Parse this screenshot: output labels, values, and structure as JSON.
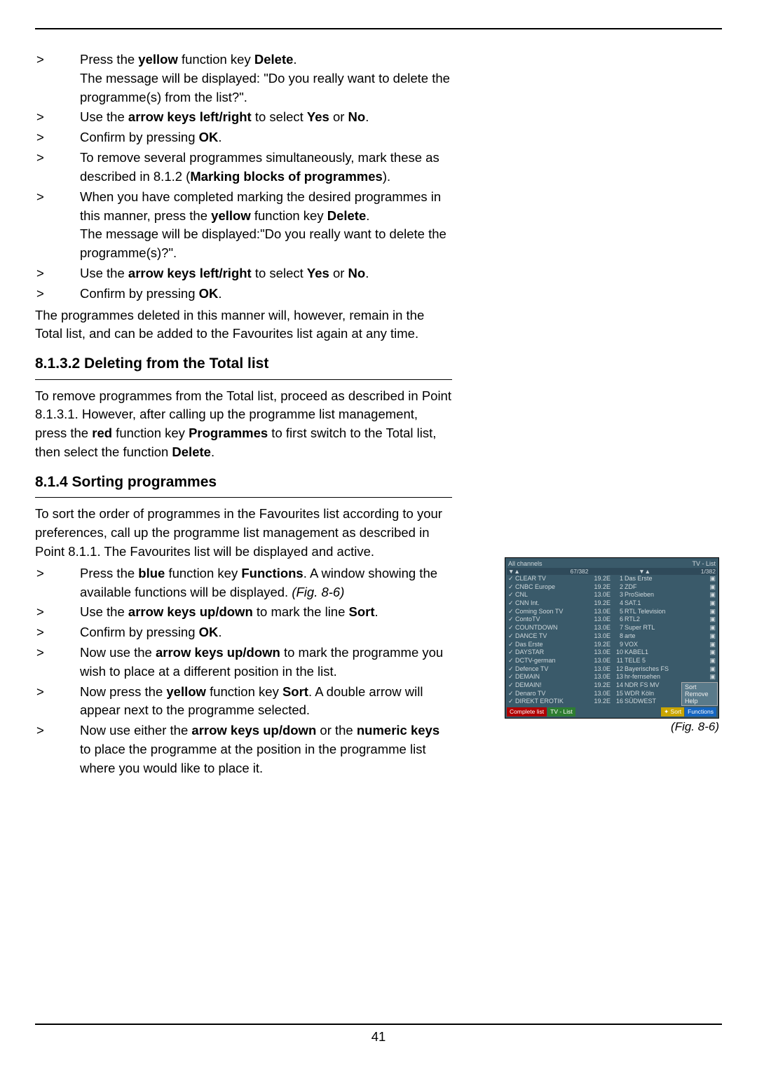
{
  "page_number": "41",
  "items": [
    {
      "marker": ">",
      "fragments": [
        {
          "t": "Press the "
        },
        {
          "t": "yellow",
          "b": 1
        },
        {
          "t": " function key "
        },
        {
          "t": "Delete",
          "b": 1
        },
        {
          "t": "."
        },
        {
          "br": 1
        },
        {
          "t": "The message will be displayed: \"Do you really want to delete the programme(s) from the list?\"."
        }
      ]
    },
    {
      "marker": ">",
      "fragments": [
        {
          "t": "Use the "
        },
        {
          "t": "arrow keys left/right",
          "b": 1
        },
        {
          "t": " to select "
        },
        {
          "t": "Yes",
          "b": 1
        },
        {
          "t": " or "
        },
        {
          "t": "No",
          "b": 1
        },
        {
          "t": "."
        }
      ]
    },
    {
      "marker": ">",
      "fragments": [
        {
          "t": "Confirm by pressing "
        },
        {
          "t": "OK",
          "b": 1
        },
        {
          "t": "."
        }
      ]
    },
    {
      "marker": ">",
      "fragments": [
        {
          "t": "To remove several programmes simultaneously, mark these as described in 8.1.2 ("
        },
        {
          "t": "Marking blocks of programmes",
          "b": 1
        },
        {
          "t": ")."
        }
      ]
    },
    {
      "marker": ">",
      "fragments": [
        {
          "t": "When you have completed marking the desired programmes in this manner, press the "
        },
        {
          "t": "yellow",
          "b": 1
        },
        {
          "t": " function key "
        },
        {
          "t": "Delete",
          "b": 1
        },
        {
          "t": "."
        },
        {
          "br": 1
        },
        {
          "t": "The message will be displayed:\"Do you really want to delete the programme(s)?\"."
        }
      ]
    },
    {
      "marker": ">",
      "fragments": [
        {
          "t": "Use the "
        },
        {
          "t": "arrow keys left/right",
          "b": 1
        },
        {
          "t": " to select "
        },
        {
          "t": "Yes",
          "b": 1
        },
        {
          "t": " or "
        },
        {
          "t": "No",
          "b": 1
        },
        {
          "t": "."
        }
      ]
    },
    {
      "marker": ">",
      "fragments": [
        {
          "t": "Confirm by pressing "
        },
        {
          "t": "OK",
          "b": 1
        },
        {
          "t": "."
        }
      ]
    }
  ],
  "after_items_para": "The programmes deleted in this manner will, however, remain in the Total list, and can be added to the Favourites list again at any time.",
  "section1_title": "8.1.3.2 Deleting from the Total list",
  "section1_body_fragments": [
    {
      "t": "To remove programmes from the Total list, proceed as described in Point 8.1.3.1. However, after calling up the programme list management, press the "
    },
    {
      "t": "red",
      "b": 1
    },
    {
      "t": " function key "
    },
    {
      "t": "Programmes",
      "b": 1
    },
    {
      "t": " to first switch to the Total list, then select the function "
    },
    {
      "t": "Delete",
      "b": 1
    },
    {
      "t": "."
    }
  ],
  "section2_title": "8.1.4 Sorting programmes",
  "section2_intro": "To sort the order of programmes in the Favourites list according to your preferences, call up the programme list management as described in Point 8.1.1. The Favourites list will be displayed and active.",
  "section2_items": [
    {
      "marker": ">",
      "fragments": [
        {
          "t": "Press the "
        },
        {
          "t": "blue",
          "b": 1
        },
        {
          "t": " function key "
        },
        {
          "t": "Functions",
          "b": 1
        },
        {
          "t": ". A window showing the available functions will be displayed. "
        },
        {
          "t": "(Fig. 8-6)",
          "i": 1
        }
      ]
    },
    {
      "marker": ">",
      "fragments": [
        {
          "t": "Use the "
        },
        {
          "t": "arrow keys up/down",
          "b": 1
        },
        {
          "t": " to mark the line  "
        },
        {
          "t": "Sort",
          "b": 1
        },
        {
          "t": "."
        }
      ]
    },
    {
      "marker": ">",
      "fragments": [
        {
          "t": "Confirm by pressing "
        },
        {
          "t": "OK",
          "b": 1
        },
        {
          "t": "."
        }
      ]
    },
    {
      "marker": ">",
      "fragments": [
        {
          "t": "Now use the "
        },
        {
          "t": "arrow keys up/down",
          "b": 1
        },
        {
          "t": " to mark the programme you wish to place at a different position in the list."
        }
      ]
    },
    {
      "marker": ">",
      "fragments": [
        {
          "t": "Now press the "
        },
        {
          "t": "yellow",
          "b": 1
        },
        {
          "t": " function key "
        },
        {
          "t": "Sort",
          "b": 1
        },
        {
          "t": ". A double arrow will appear next to the programme selected."
        }
      ]
    },
    {
      "marker": ">",
      "fragments": [
        {
          "t": "Now use either the "
        },
        {
          "t": "arrow keys up/down",
          "b": 1
        },
        {
          "t": " or the "
        },
        {
          "t": "numeric keys",
          "b": 1
        },
        {
          "t": " to place the programme at the position in the programme list where you would like to place it."
        }
      ]
    }
  ],
  "figure": {
    "caption": "(Fig. 8-6)",
    "header_left": "All channels",
    "header_right": "TV - List",
    "count_left": "67/382",
    "count_right": "1/382",
    "left": [
      {
        "n": "CLEAR TV",
        "f": "19.2E"
      },
      {
        "n": "CNBC Europe",
        "f": "19.2E"
      },
      {
        "n": "CNL",
        "f": "13.0E"
      },
      {
        "n": "CNN Int.",
        "f": "19.2E"
      },
      {
        "n": "Coming Soon TV",
        "f": "13.0E"
      },
      {
        "n": "ContoTV",
        "f": "13.0E"
      },
      {
        "n": "COUNTDOWN",
        "f": "13.0E"
      },
      {
        "n": "DANCE TV",
        "f": "13.0E"
      },
      {
        "n": "Das Erste",
        "f": "19.2E"
      },
      {
        "n": "DAYSTAR",
        "f": "13.0E"
      },
      {
        "n": "DCTV-german",
        "f": "13.0E"
      },
      {
        "n": "Defence TV",
        "f": "13.0E"
      },
      {
        "n": "DEMAIN",
        "f": "13.0E"
      },
      {
        "n": "DEMAIN!",
        "f": "19.2E"
      },
      {
        "n": "Denaro TV",
        "f": "13.0E"
      },
      {
        "n": "DIREKT EROTIK",
        "f": "19.2E"
      }
    ],
    "right": [
      {
        "i": "1",
        "n": "Das Erste"
      },
      {
        "i": "2",
        "n": "ZDF"
      },
      {
        "i": "3",
        "n": "ProSieben"
      },
      {
        "i": "4",
        "n": "SAT.1"
      },
      {
        "i": "5",
        "n": "RTL Television"
      },
      {
        "i": "6",
        "n": "RTL2"
      },
      {
        "i": "7",
        "n": "Super RTL"
      },
      {
        "i": "8",
        "n": "arte"
      },
      {
        "i": "9",
        "n": "VOX"
      },
      {
        "i": "10",
        "n": "KABEL1"
      },
      {
        "i": "11",
        "n": "TELE 5"
      },
      {
        "i": "12",
        "n": "Bayerisches FS"
      },
      {
        "i": "13",
        "n": "hr-fernsehen"
      },
      {
        "i": "14",
        "n": "NDR FS MV"
      },
      {
        "i": "15",
        "n": "WDR Köln"
      },
      {
        "i": "16",
        "n": "SÜDWEST"
      }
    ],
    "popup": [
      "Sort",
      "Remove",
      "Help"
    ],
    "bottom": {
      "red": "Complete list",
      "green": "TV - List",
      "yellow": "Sort",
      "blue": "Functions"
    }
  }
}
